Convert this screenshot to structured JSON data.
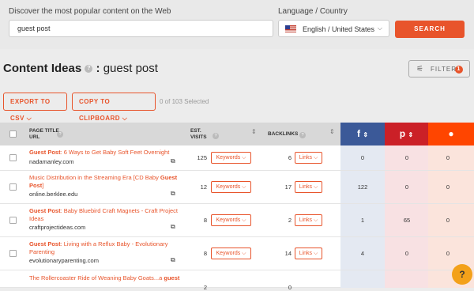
{
  "search": {
    "label": "Discover the most popular content on the Web",
    "value": "guest post",
    "button": "SEARCH"
  },
  "language": {
    "label": "Language / Country",
    "value": "English / United States"
  },
  "header": {
    "title": "Content Ideas",
    "colon": ":",
    "query": "guest post",
    "filter": "FILTER",
    "filter_count": "1"
  },
  "toolbar": {
    "export": "EXPORT TO CSV",
    "copy": "COPY TO CLIPBOARD",
    "selected": "0 of 103 Selected"
  },
  "table": {
    "headers": {
      "page_title": "PAGE TITLE",
      "url": "URL",
      "est": "EST.",
      "visits": "VISITS",
      "backlinks": "BACKLINKS"
    },
    "keywords_label": "Keywords",
    "links_label": "Links",
    "rows": [
      {
        "title_bold": "Guest Post",
        "title_rest": ": 6 Ways to Get Baby Soft Feet Overnight",
        "domain": "nadamanley.com",
        "visits": "125",
        "backlinks": "6",
        "fb": "0",
        "pin": "0",
        "reddit": "0"
      },
      {
        "title_rest": "Music Distribution in the Streaming Era [CD Baby ",
        "title_bold2": "Guest",
        "title_line2_bold": "Post",
        "title_line2": "]",
        "domain": "online.berklee.edu",
        "visits": "12",
        "backlinks": "17",
        "fb": "122",
        "pin": "0",
        "reddit": "0"
      },
      {
        "title_bold": "Guest Post",
        "title_rest": ": Baby Bluebird Craft Magnets - Craft Project",
        "title_line2": "Ideas",
        "domain": "craftprojectideas.com",
        "visits": "8",
        "backlinks": "2",
        "fb": "1",
        "pin": "65",
        "reddit": "0"
      },
      {
        "title_bold": "Guest Post",
        "title_rest": ": Living with a Reflux Baby - Evolutionary",
        "title_line2": "Parenting",
        "domain": "evolutionaryparenting.com",
        "visits": "8",
        "backlinks": "14",
        "fb": "4",
        "pin": "0",
        "reddit": "0"
      },
      {
        "title_rest": "The Rollercoaster Ride of Weaning Baby Goats...a ",
        "title_bold2": "guest",
        "domain": "",
        "visits": "2",
        "backlinks": "0",
        "fb": "",
        "pin": "",
        "reddit": ""
      }
    ]
  },
  "colors": {
    "accent": "#e8542b",
    "facebook": "#3b5998",
    "pinterest": "#cb2027",
    "reddit": "#ff4500"
  },
  "icons": [
    "help-icon",
    "filter-sliders-icon",
    "external-link-icon",
    "sort-icon",
    "chat-help-icon"
  ]
}
